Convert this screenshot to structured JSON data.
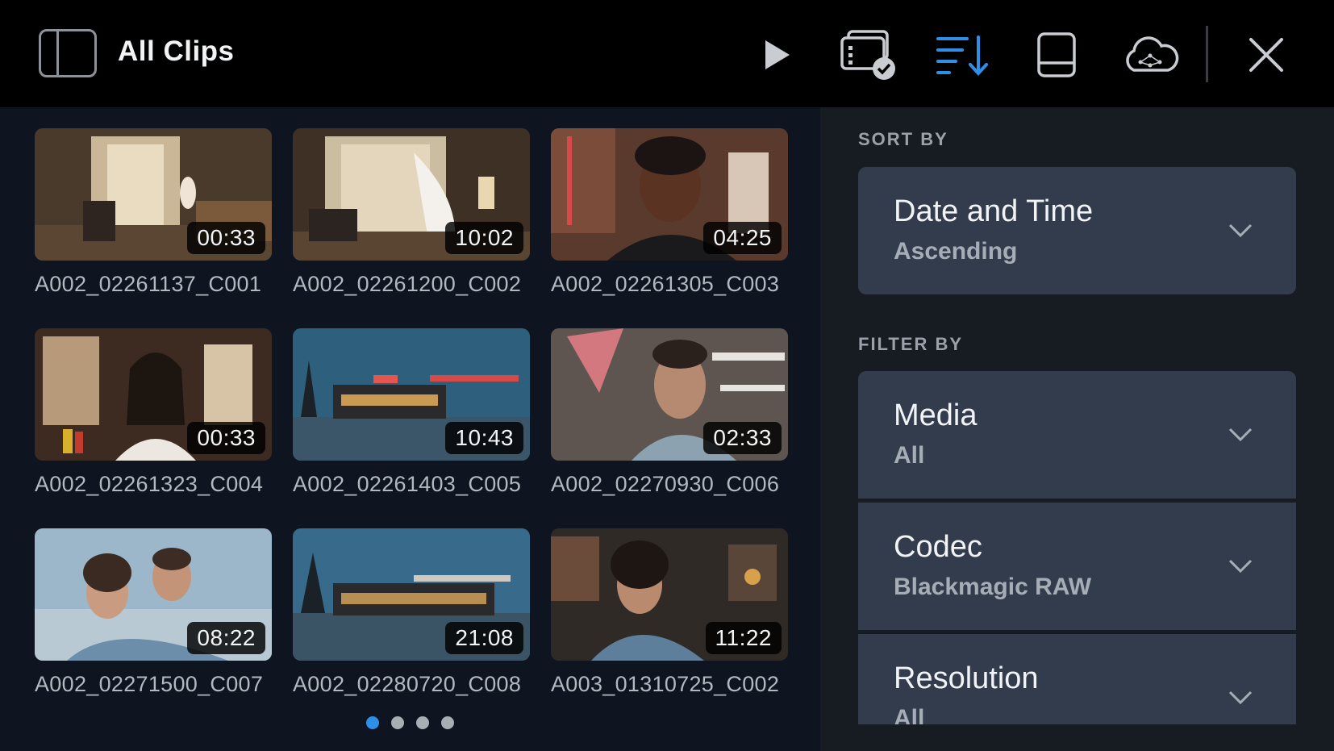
{
  "header": {
    "title": "All Clips",
    "icons": [
      "sidebar-toggle-icon",
      "play-icon",
      "cards-check-icon",
      "sort-icon",
      "drive-icon",
      "cloud-icon",
      "close-icon"
    ],
    "accent_color": "#2e8fe8"
  },
  "clips": [
    {
      "name": "A002_02261137_C001",
      "duration": "00:33"
    },
    {
      "name": "A002_02261200_C002",
      "duration": "10:02"
    },
    {
      "name": "A002_02261305_C003",
      "duration": "04:25"
    },
    {
      "name": "A002_02261323_C004",
      "duration": "00:33"
    },
    {
      "name": "A002_02261403_C005",
      "duration": "10:43"
    },
    {
      "name": "A002_02270930_C006",
      "duration": "02:33"
    },
    {
      "name": "A002_02271500_C007",
      "duration": "08:22"
    },
    {
      "name": "A002_02280720_C008",
      "duration": "21:08"
    },
    {
      "name": "A003_01310725_C002",
      "duration": "11:22"
    }
  ],
  "pagination": {
    "total": 4,
    "active": 1
  },
  "panel": {
    "sort_label": "SORT BY",
    "sort": {
      "title": "Date and Time",
      "value": "Ascending"
    },
    "filter_label": "FILTER BY",
    "filters": [
      {
        "title": "Media",
        "value": "All"
      },
      {
        "title": "Codec",
        "value": "Blackmagic RAW"
      },
      {
        "title": "Resolution",
        "value": "All"
      }
    ]
  }
}
